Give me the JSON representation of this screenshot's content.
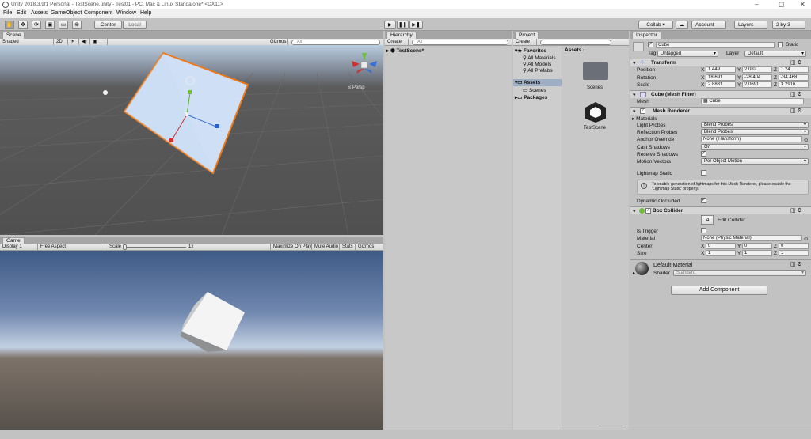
{
  "window": {
    "title": "Unity 2018.3.9f1 Personal - TestScene.unity - Test01 - PC, Mac & Linux Standalone* <DX11>",
    "minimize": "–",
    "maximize": "▢",
    "close": "✕"
  },
  "menu": [
    "File",
    "Edit",
    "Assets",
    "GameObject",
    "Component",
    "Window",
    "Help"
  ],
  "toolbar": {
    "tools": [
      "✋",
      "✥",
      "⟳",
      "▣",
      "▭",
      "⊕"
    ],
    "pivot": "Center",
    "space": "Local",
    "play": "▶",
    "pause": "❚❚",
    "step": "▶❚",
    "collab": "Collab ▾",
    "cloud": "☁",
    "account": "Account",
    "layers": "Layers",
    "layout": "2 by 3"
  },
  "scene": {
    "tab": "Scene",
    "shading": "Shaded",
    "mode2d": "2D",
    "light": "☀",
    "audio": "◀)",
    "fx": "▣",
    "gizmos": "Gizmos",
    "search_placeholder": "All",
    "persp": "≤ Persp"
  },
  "game": {
    "tab": "Game",
    "display": "Display 1",
    "aspect": "Free Aspect",
    "scale_label": "Scale",
    "scale_value": "1x",
    "maximize": "Maximize On Play",
    "mute": "Mute Audio",
    "stats": "Stats",
    "gizmos": "Gizmos"
  },
  "hierarchy": {
    "tab": "Hierarchy",
    "create": "Create",
    "search_placeholder": "All",
    "scene_name": "TestScene*"
  },
  "project": {
    "tab": "Project",
    "create": "Create",
    "favorites": "Favorites",
    "fav_items": [
      "All Materials",
      "All Models",
      "All Prefabs"
    ],
    "assets": "Assets",
    "asset_children": [
      "Scenes"
    ],
    "packages": "Packages",
    "breadcrumb": "Assets",
    "grid_items": [
      "Scenes",
      "TestScene"
    ]
  },
  "inspector": {
    "tab": "Inspector",
    "object_name": "Cube",
    "static_label": "Static",
    "tag_label": "Tag",
    "tag_value": "Untagged",
    "layer_label": "Layer",
    "layer_value": "Default",
    "transform": {
      "title": "Transform",
      "rows": [
        {
          "label": "Position",
          "x": "1.449",
          "y": "2.082",
          "z": "1.24"
        },
        {
          "label": "Rotation",
          "x": "18.691",
          "y": "-28.404",
          "z": "-34.468"
        },
        {
          "label": "Scale",
          "x": "2.8831",
          "y": "2.0691",
          "z": "3.2916"
        }
      ]
    },
    "mesh_filter": {
      "title": "Cube (Mesh Filter)",
      "mesh_label": "Mesh",
      "mesh_value": "Cube"
    },
    "mesh_renderer": {
      "title": "Mesh Renderer",
      "materials": "Materials",
      "rows": [
        {
          "label": "Light Probes",
          "value": "Blend Probes",
          "kind": "dd"
        },
        {
          "label": "Reflection Probes",
          "value": "Blend Probes",
          "kind": "dd"
        },
        {
          "label": "Anchor Override",
          "value": "None (Transform)",
          "kind": "field"
        },
        {
          "label": "Cast Shadows",
          "value": "On",
          "kind": "dd"
        },
        {
          "label": "Receive Shadows",
          "value": "✓",
          "kind": "chk"
        },
        {
          "label": "Motion Vectors",
          "value": "Per Object Motion",
          "kind": "dd"
        }
      ],
      "lightmap_static": "Lightmap Static",
      "info": "To enable generation of lightmaps for this Mesh Renderer, please enable the 'Lightmap Static' property.",
      "dynamic_occluded": "Dynamic Occluded"
    },
    "box_collider": {
      "title": "Box Collider",
      "edit_collider": "Edit Collider",
      "is_trigger": "Is Trigger",
      "material_label": "Material",
      "material_value": "None (Physic Material)",
      "center_label": "Center",
      "center": {
        "x": "0",
        "y": "0",
        "z": "0"
      },
      "size_label": "Size",
      "size": {
        "x": "1",
        "y": "1",
        "z": "1"
      }
    },
    "material": {
      "name": "Default-Material",
      "shader_label": "Shader",
      "shader_value": "Standard"
    },
    "add_component": "Add Component"
  },
  "colors": {
    "selection_orange": "#f07a17",
    "panel_gray": "#c2c2c2",
    "cube_face": "#c7dbf3"
  }
}
